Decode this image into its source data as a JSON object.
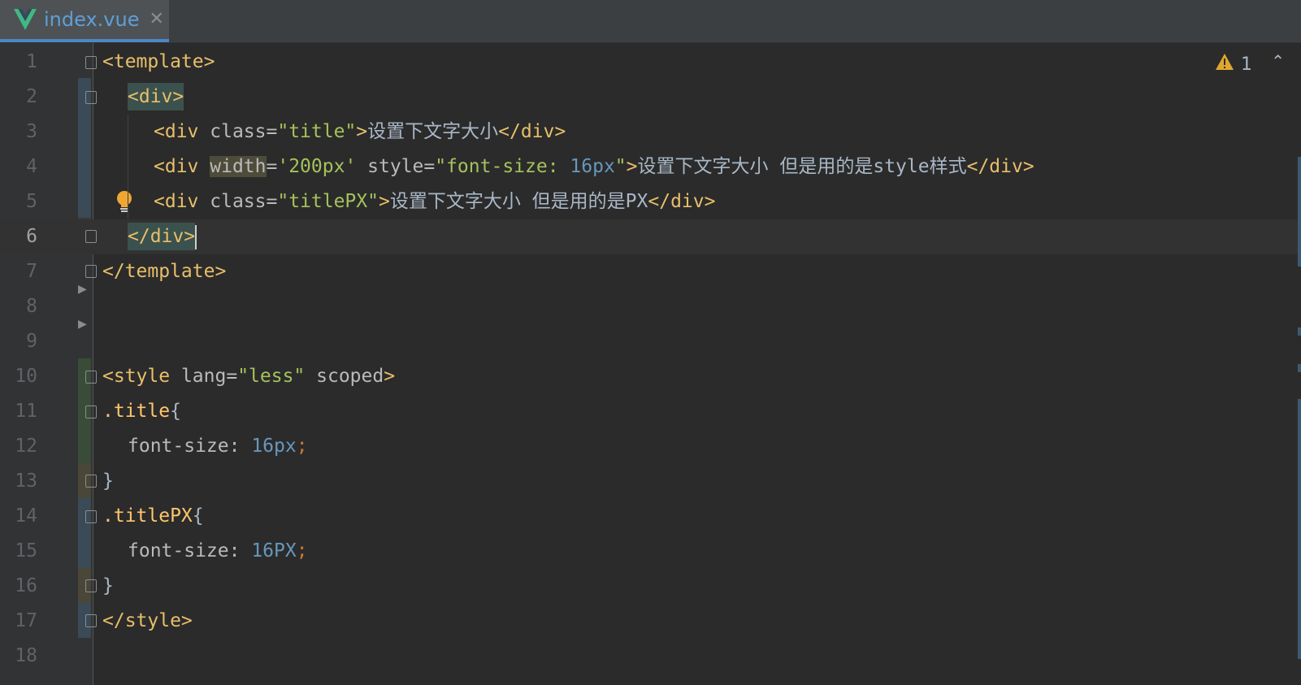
{
  "tab": {
    "label": "index.vue",
    "close": "✕",
    "icon": "vue-logo-icon",
    "accent": "#4a88c7"
  },
  "inspection": {
    "warnings": "1",
    "up": "⌃"
  },
  "line_numbers": [
    "1",
    "2",
    "3",
    "4",
    "5",
    "6",
    "7",
    "8",
    "9",
    "10",
    "11",
    "12",
    "13",
    "14",
    "15",
    "16",
    "17",
    "18"
  ],
  "code": {
    "l1": {
      "tag": "<template>"
    },
    "l2": {
      "tag": "<div>"
    },
    "l3": {
      "open": "<div ",
      "attr": "class=",
      "val": "\"title\"",
      "close": ">",
      "text": "设置下文字大小",
      "end": "</div>"
    },
    "l4": {
      "open": "<div ",
      "attr1": "width",
      "eq1": "=",
      "val1": "'200px'",
      "attr2": " style=",
      "val2a": "\"font-size: ",
      "val2num": "16px",
      "val2b": "\"",
      "close": ">",
      "text": "设置下文字大小 但是用的是style样式",
      "end": "</div>"
    },
    "l5": {
      "open": "<div ",
      "attr": "class=",
      "val": "\"titlePX\"",
      "close": ">",
      "text": "设置下文字大小 但是用的是PX",
      "end": "</div>"
    },
    "l6": {
      "tag": "</div>"
    },
    "l7": {
      "tag": "</template>"
    },
    "l10": {
      "open": "<style ",
      "attr": "lang=",
      "val": "\"less\"",
      "attr2": " scoped",
      "close": ">"
    },
    "l11": {
      "sel": ".title",
      "brace": "{"
    },
    "l12": {
      "prop": "font-size: ",
      "num": "16px",
      "semi": ";"
    },
    "l13": {
      "brace": "}"
    },
    "l14": {
      "sel": ".titlePX",
      "brace": "{"
    },
    "l15": {
      "prop": "font-size: ",
      "num": "16PX",
      "semi": ";"
    },
    "l16": {
      "brace": "}"
    },
    "l17": {
      "tag": "</style>"
    }
  }
}
